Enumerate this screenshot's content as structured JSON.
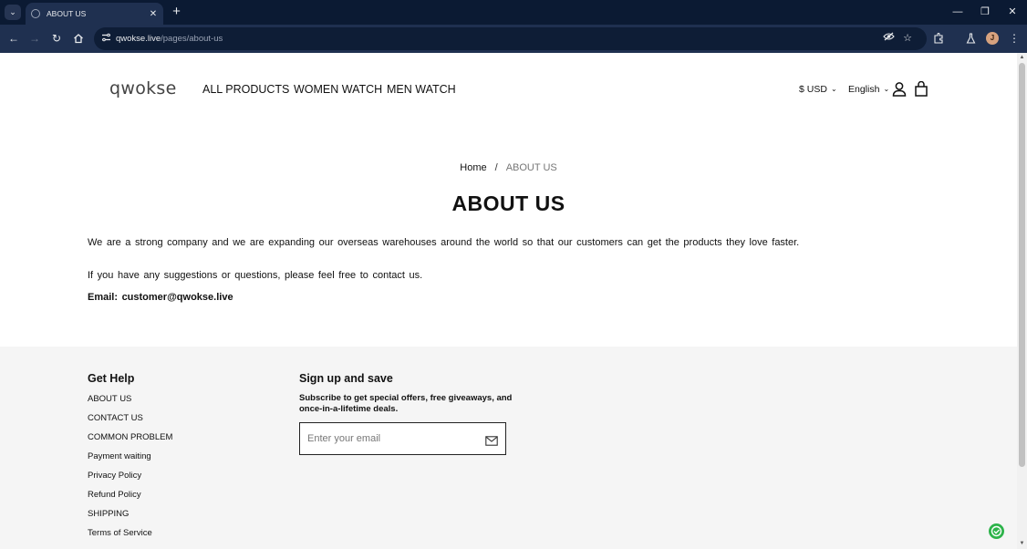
{
  "browser": {
    "tab_title": "ABOUT US",
    "tab_close": "✕",
    "new_tab": "+",
    "url_host": "qwokse.live",
    "url_path": "/pages/about-us",
    "profile_initial": "J",
    "window_controls": [
      "—",
      "❐",
      "✕"
    ]
  },
  "header": {
    "logo": "qwokse",
    "nav": [
      "ALL PRODUCTS",
      "WOMEN WATCH",
      "MEN WATCH"
    ],
    "currency": "$ USD",
    "language": "English"
  },
  "breadcrumb": {
    "home": "Home",
    "separator": "/",
    "current": "ABOUT US"
  },
  "content": {
    "title": "ABOUT US",
    "paragraph_1": "We are a strong company and we are expanding our overseas warehouses around the world so that our customers can get the products they love faster.",
    "paragraph_2": "If you have any suggestions or questions, please feel free to contact us.",
    "email_line": "Email: customer@qwokse.live"
  },
  "footer": {
    "help_heading": "Get Help",
    "help_links": [
      "ABOUT US",
      "CONTACT US",
      "COMMON PROBLEM",
      "Payment waiting",
      "Privacy Policy",
      "Refund Policy",
      "SHIPPING",
      "Terms of Service"
    ],
    "signup_heading": "Sign up and save",
    "signup_text": "Subscribe to get special offers, free giveaways, and once-in-a-lifetime deals.",
    "email_placeholder": "Enter your email",
    "email_value": ""
  },
  "icons": {
    "chevron": "⌄",
    "mail": "mail-icon",
    "account": "user-icon",
    "cart": "bag-icon",
    "chat": "chat-icon"
  },
  "colors": {
    "tabbar": "#0b1a33",
    "toolbar": "#1f3050",
    "footer_bg": "#f5f5f5",
    "chat_green": "#2db34a"
  }
}
